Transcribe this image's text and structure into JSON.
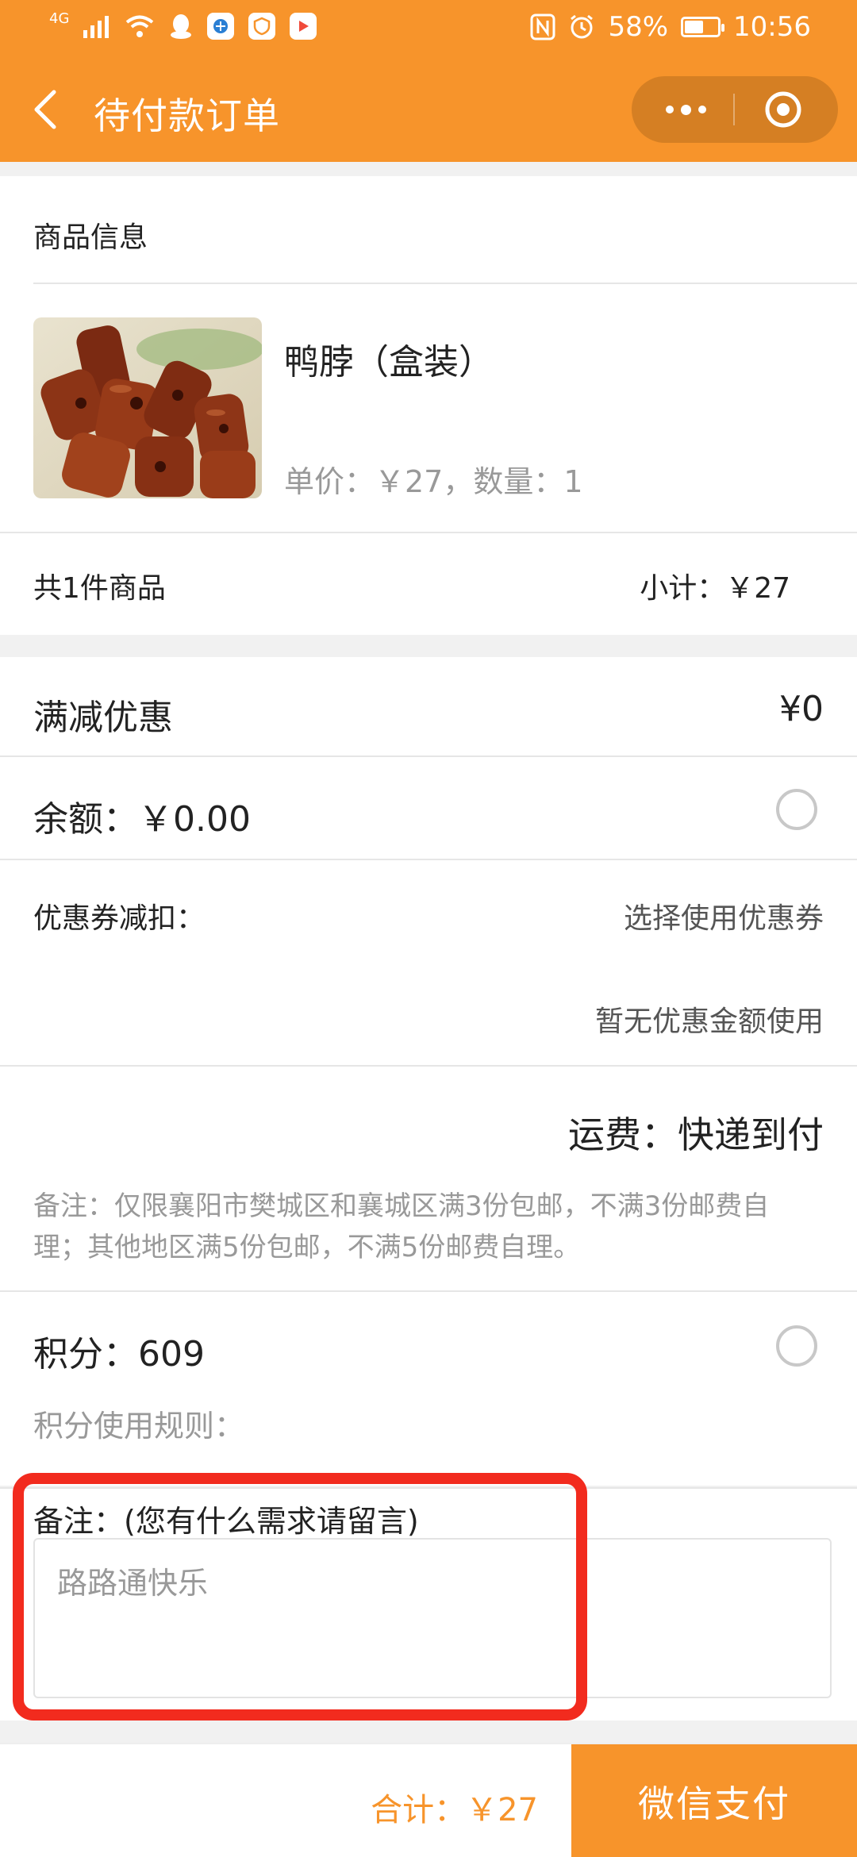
{
  "status_bar": {
    "signal_label": "4G",
    "battery_percent": "58%",
    "battery_level": 0.58,
    "time": "10:56",
    "icons": [
      "signal-icon",
      "wifi-icon",
      "qq-icon",
      "app-icon",
      "shield-icon",
      "video-icon",
      "nfc-icon",
      "alarm-icon",
      "battery-icon"
    ]
  },
  "nav": {
    "title": "待付款订单",
    "back_icon": "chevron-left-icon",
    "more_icon": "more-dots-icon",
    "close_icon": "target-circle-icon"
  },
  "product_section": {
    "header": "商品信息",
    "product": {
      "name": "鸭脖（盒装）",
      "price_qty": "单价：￥27，数量：1"
    },
    "count_text": "共1件商品",
    "subtotal_text": "小计：￥27"
  },
  "discounts": {
    "full_reduction_label": "满减优惠",
    "full_reduction_value": "¥0",
    "balance_label": "余额：￥0.00",
    "coupon_label": "优惠券减扣：",
    "coupon_action": "选择使用优惠券",
    "coupon_status": "暂无优惠金额使用"
  },
  "shipping": {
    "label": "运费：快递到付",
    "note": "备注：仅限襄阳市樊城区和襄城区满3份包邮，不满3份邮费自理；其他地区满5份包邮，不满5份邮费自理。"
  },
  "points": {
    "label": "积分：609",
    "rules_label": "积分使用规则："
  },
  "remark": {
    "label": "备注：(您有什么需求请留言)",
    "value": "路路通快乐"
  },
  "footer": {
    "total_text": "合计：￥27",
    "pay_button": "微信支付"
  },
  "colors": {
    "brand": "#f7942b",
    "highlight": "#f22b1e"
  }
}
